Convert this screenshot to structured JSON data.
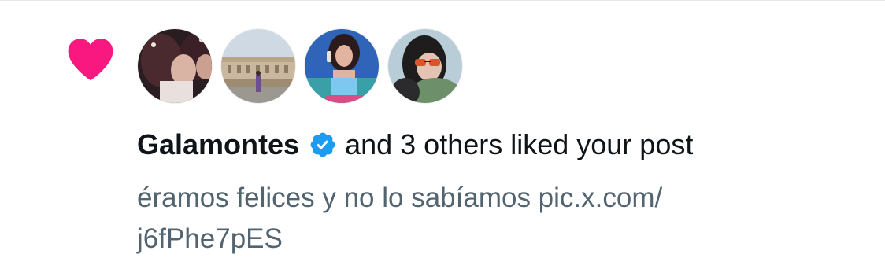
{
  "colors": {
    "heart": "#f91880",
    "verified_badge": "#1d9bf0",
    "primary_text": "#0f1419",
    "secondary_text": "#536471"
  },
  "icons": {
    "notification_type": "heart-icon",
    "badge": "verified-badge-icon"
  },
  "notification": {
    "avatars": [
      {
        "name": "avatar-1"
      },
      {
        "name": "avatar-2"
      },
      {
        "name": "avatar-3"
      },
      {
        "name": "avatar-4"
      }
    ],
    "username": "Galamontes",
    "action_text": "and 3 others liked your post",
    "post_text_line1": "éramos felices y no lo sabíamos pic.x.com/",
    "post_text_line2": "j6fPhe7pES"
  }
}
